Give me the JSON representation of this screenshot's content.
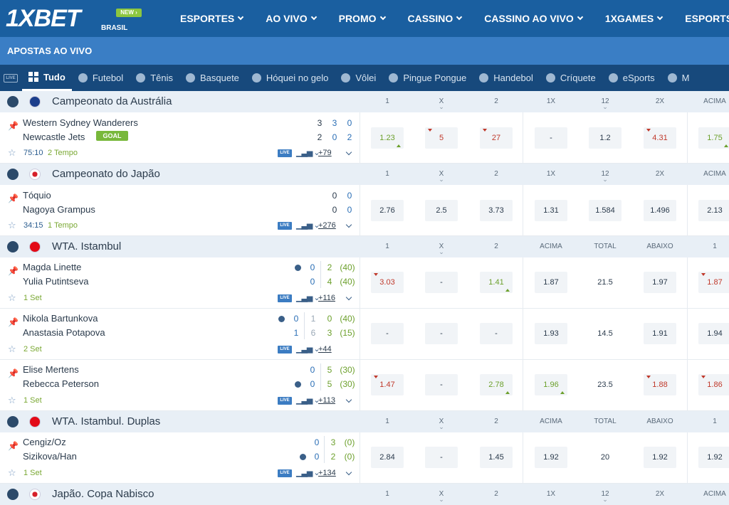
{
  "header": {
    "logo": "1XBET",
    "new_badge": "NEW",
    "region": "BRASIL",
    "nav": [
      "ESPORTES",
      "AO VIVO",
      "PROMO",
      "CASSINO",
      "CASSINO AO VIVO",
      "1XGAMES",
      "ESPORTS"
    ]
  },
  "subheader": {
    "title": "APOSTAS AO VIVO"
  },
  "tabs": {
    "live_label": "LIVE",
    "items": [
      "Tudo",
      "Futebol",
      "Tênis",
      "Basquete",
      "Hóquei no gelo",
      "Vôlei",
      "Pingue Pongue",
      "Handebol",
      "Críquete",
      "eSports",
      "M"
    ]
  },
  "live_label": "LIVE",
  "goal_label": "GOAL",
  "leagues": [
    {
      "name": "Campeonato da Austrália",
      "cols": [
        "1",
        "X",
        "2",
        "1X",
        "12",
        "2X",
        "ACIMA"
      ],
      "matches": [
        {
          "team1": "Western Sydney Wanderers",
          "team2": "Newcastle Jets",
          "s1": [
            "3",
            "3",
            "0"
          ],
          "s2": [
            "2",
            "0",
            "2"
          ],
          "time": "75:10",
          "period": "2 Tempo",
          "more": "+79",
          "odds": [
            "1.23",
            "5",
            "27",
            "-",
            "1.2",
            "4.31",
            "1.75"
          ]
        }
      ]
    },
    {
      "name": "Campeonato do Japão",
      "cols": [
        "1",
        "X",
        "2",
        "1X",
        "12",
        "2X",
        "ACIMA"
      ],
      "matches": [
        {
          "team1": "Tóquio",
          "team2": "Nagoya Grampus",
          "s1": [
            "0",
            "0"
          ],
          "s2": [
            "0",
            "0"
          ],
          "time": "34:15",
          "period": "1 Tempo",
          "more": "+276",
          "odds": [
            "2.76",
            "2.5",
            "3.73",
            "1.31",
            "1.584",
            "1.496",
            "2.13"
          ]
        }
      ]
    },
    {
      "name": "WTA. Istambul",
      "cols": [
        "1",
        "X",
        "2",
        "ACIMA",
        "TOTAL",
        "ABAIXO",
        "1"
      ],
      "matches": [
        {
          "team1": "Magda Linette",
          "team2": "Yulia Putintseva",
          "s1": [
            "0",
            "2",
            "(40)"
          ],
          "s2": [
            "0",
            "4",
            "(40)"
          ],
          "period": "1 Set",
          "more": "+116",
          "odds": [
            "3.03",
            "-",
            "1.41",
            "1.87",
            "21.5",
            "1.97",
            "1.87"
          ]
        },
        {
          "team1": "Nikola Bartunkova",
          "team2": "Anastasia Potapova",
          "s1": [
            "0",
            "1",
            "0",
            "(40)"
          ],
          "s2": [
            "1",
            "6",
            "3",
            "(15)"
          ],
          "period": "2 Set",
          "more": "+44",
          "odds": [
            "-",
            "-",
            "-",
            "1.93",
            "14.5",
            "1.91",
            "1.94"
          ]
        },
        {
          "team1": "Elise Mertens",
          "team2": "Rebecca Peterson",
          "s1": [
            "0",
            "5",
            "(30)"
          ],
          "s2": [
            "0",
            "5",
            "(30)"
          ],
          "period": "1 Set",
          "more": "+113",
          "odds": [
            "1.47",
            "-",
            "2.78",
            "1.96",
            "23.5",
            "1.88",
            "1.86"
          ]
        }
      ]
    },
    {
      "name": "WTA. Istambul. Duplas",
      "cols": [
        "1",
        "X",
        "2",
        "ACIMA",
        "TOTAL",
        "ABAIXO",
        "1"
      ],
      "matches": [
        {
          "team1": "Cengiz/Oz",
          "team2": "Sizikova/Han",
          "s1": [
            "0",
            "3",
            "(0)"
          ],
          "s2": [
            "0",
            "2",
            "(0)"
          ],
          "period": "1 Set",
          "more": "+134",
          "odds": [
            "2.84",
            "-",
            "1.45",
            "1.92",
            "20",
            "1.92",
            "1.92"
          ]
        }
      ]
    },
    {
      "name": "Japão. Copa Nabisco",
      "cols": [
        "1",
        "X",
        "2",
        "1X",
        "12",
        "2X",
        "ACIMA"
      ]
    }
  ],
  "colors": {
    "header": "#1a5fa0",
    "subheader": "#3a7ec5",
    "tabs": "#17497c",
    "down": "#c0392b",
    "up": "#6ca02c"
  }
}
